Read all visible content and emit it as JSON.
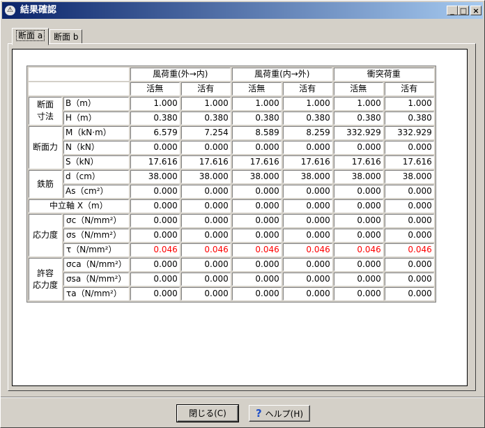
{
  "window": {
    "title": "結果確認"
  },
  "tabs": [
    "断面 a",
    "断面 b"
  ],
  "table": {
    "group_headers": [
      "風荷重(外→内)",
      "風荷重(内→外)",
      "衝突荷重"
    ],
    "sub_headers": [
      "活無",
      "活有",
      "活無",
      "活有",
      "活無",
      "活有"
    ],
    "groups": {
      "dim": "断面\n寸法",
      "force": "断面力",
      "rebar": "鉄筋",
      "stress": "応力度",
      "allow": "許容\n応力度"
    },
    "rows": [
      {
        "label": "B（m）",
        "values": [
          "1.000",
          "1.000",
          "1.000",
          "1.000",
          "1.000",
          "1.000"
        ]
      },
      {
        "label": "H（m）",
        "values": [
          "0.380",
          "0.380",
          "0.380",
          "0.380",
          "0.380",
          "0.380"
        ]
      },
      {
        "label": "M（kN·m）",
        "values": [
          "6.579",
          "7.254",
          "8.589",
          "8.259",
          "332.929",
          "332.929"
        ]
      },
      {
        "label": "N（kN）",
        "values": [
          "0.000",
          "0.000",
          "0.000",
          "0.000",
          "0.000",
          "0.000"
        ]
      },
      {
        "label": "S（kN）",
        "values": [
          "17.616",
          "17.616",
          "17.616",
          "17.616",
          "17.616",
          "17.616"
        ]
      },
      {
        "label": "d（cm）",
        "values": [
          "38.000",
          "38.000",
          "38.000",
          "38.000",
          "38.000",
          "38.000"
        ]
      },
      {
        "label": "As（cm²）",
        "values": [
          "0.000",
          "0.000",
          "0.000",
          "0.000",
          "0.000",
          "0.000"
        ]
      },
      {
        "label": "中立軸 X（m）",
        "values": [
          "0.000",
          "0.000",
          "0.000",
          "0.000",
          "0.000",
          "0.000"
        ]
      },
      {
        "label": "σc（N/mm²）",
        "values": [
          "0.000",
          "0.000",
          "0.000",
          "0.000",
          "0.000",
          "0.000"
        ]
      },
      {
        "label": "σs（N/mm²）",
        "values": [
          "0.000",
          "0.000",
          "0.000",
          "0.000",
          "0.000",
          "0.000"
        ]
      },
      {
        "label": "τ（N/mm²）",
        "values": [
          "0.046",
          "0.046",
          "0.046",
          "0.046",
          "0.046",
          "0.046"
        ]
      },
      {
        "label": "σca（N/mm²）",
        "values": [
          "0.000",
          "0.000",
          "0.000",
          "0.000",
          "0.000",
          "0.000"
        ]
      },
      {
        "label": "σsa（N/mm²）",
        "values": [
          "0.000",
          "0.000",
          "0.000",
          "0.000",
          "0.000",
          "0.000"
        ]
      },
      {
        "label": "τa（N/mm²）",
        "values": [
          "0.000",
          "0.000",
          "0.000",
          "0.000",
          "0.000",
          "0.000"
        ]
      }
    ]
  },
  "buttons": {
    "close": "閉じる(C)",
    "help": "ヘルプ(H)"
  },
  "colors": {
    "warning_value": "#ff0000",
    "title_bar": "#0a246a"
  }
}
